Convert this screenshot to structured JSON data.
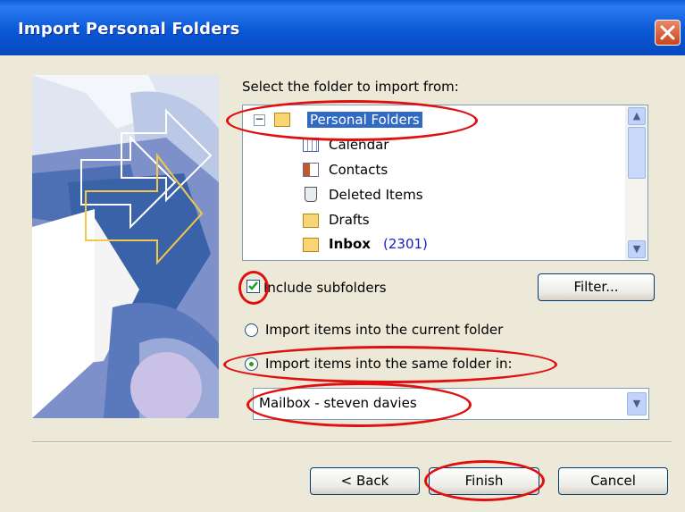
{
  "window": {
    "title": "Import Personal Folders"
  },
  "prompt": {
    "select_folder": "Select the folder to import from:"
  },
  "tree": {
    "items": [
      {
        "label": "Personal Folders",
        "icon": "folder-tree-icon"
      },
      {
        "label": "Calendar",
        "icon": "calendar-icon"
      },
      {
        "label": "Contacts",
        "icon": "contacts-icon"
      },
      {
        "label": "Deleted Items",
        "icon": "deleted-items-icon"
      },
      {
        "label": "Drafts",
        "icon": "folder-icon"
      },
      {
        "label": "Inbox",
        "count": "(2301)",
        "icon": "folder-icon"
      }
    ],
    "expand_symbol": "−"
  },
  "options": {
    "include_subfolders": "Include subfolders",
    "include_subfolders_checked": true,
    "filter_button": "Filter...",
    "import_current": "Import items into the current folder",
    "import_same": "Import items into the same folder in:",
    "selected_option": "import_same"
  },
  "combo": {
    "value": "Mailbox - steven davies"
  },
  "buttons": {
    "back": "< Back",
    "finish": "Finish",
    "cancel": "Cancel"
  },
  "colors": {
    "title_bar": "#0a5fd8",
    "selection": "#316ac5",
    "inbox_count": "#1a1ac8",
    "annotation": "#e01010",
    "close_button": "#d9512b"
  }
}
